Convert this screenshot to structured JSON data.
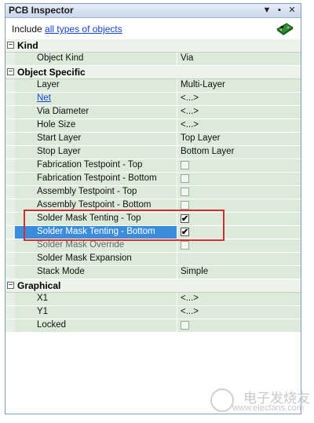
{
  "window": {
    "title": "PCB Inspector",
    "menu_glyph": "▼",
    "pin_glyph": "▪",
    "close_glyph": "✕"
  },
  "filter": {
    "prefix": "Include",
    "link": "all types of objects"
  },
  "categories": [
    {
      "label": "Kind",
      "toggle": "−",
      "rows": [
        {
          "label": "Object Kind",
          "value": "Via",
          "type": "text"
        }
      ]
    },
    {
      "label": "Object Specific",
      "toggle": "−",
      "rows": [
        {
          "label": "Layer",
          "value": "Multi-Layer",
          "type": "text"
        },
        {
          "label": "Net",
          "value": "<...>",
          "type": "text",
          "link": true
        },
        {
          "label": "Via Diameter",
          "value": "<...>",
          "type": "text"
        },
        {
          "label": "Hole Size",
          "value": "<...>",
          "type": "text"
        },
        {
          "label": "Start Layer",
          "value": "Top Layer",
          "type": "text"
        },
        {
          "label": "Stop Layer",
          "value": "Bottom Layer",
          "type": "text"
        },
        {
          "label": "Fabrication Testpoint - Top",
          "checked": false,
          "type": "check"
        },
        {
          "label": "Fabrication Testpoint - Bottom",
          "checked": false,
          "type": "check"
        },
        {
          "label": "Assembly Testpoint - Top",
          "checked": false,
          "type": "check"
        },
        {
          "label": "Assembly Testpoint - Bottom",
          "checked": false,
          "type": "check"
        },
        {
          "label": "Solder Mask Tenting - Top",
          "checked": true,
          "type": "check"
        },
        {
          "label": "Solder Mask Tenting - Bottom",
          "checked": true,
          "type": "check",
          "selected": true
        },
        {
          "label": "Solder Mask Override",
          "checked": false,
          "type": "check",
          "dim": true
        },
        {
          "label": "Solder Mask Expansion",
          "value": "",
          "type": "text"
        },
        {
          "label": "Stack Mode",
          "value": "Simple",
          "type": "text"
        }
      ]
    },
    {
      "label": "Graphical",
      "toggle": "−",
      "rows": [
        {
          "label": "X1",
          "value": "<...>",
          "type": "text"
        },
        {
          "label": "Y1",
          "value": "<...>",
          "type": "text"
        },
        {
          "label": "Locked",
          "checked": false,
          "type": "check"
        }
      ]
    }
  ],
  "check_glyph": "✔",
  "watermark": {
    "line1": "电子发烧友",
    "line2": "www.elecfans.com"
  }
}
